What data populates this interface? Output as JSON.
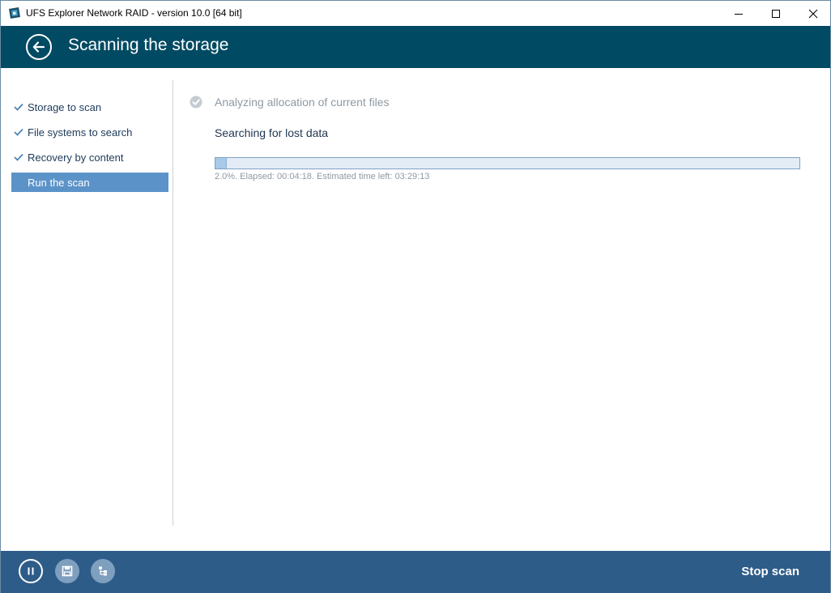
{
  "window": {
    "title": "UFS Explorer Network RAID - version 10.0 [64 bit]",
    "controls": [
      "minimize-icon",
      "maximize-icon",
      "close-icon"
    ]
  },
  "header": {
    "title": "Scanning the storage",
    "back_icon": "back-arrow-icon"
  },
  "sidebar": {
    "steps": [
      {
        "label": "Storage to scan",
        "state": "done"
      },
      {
        "label": "File systems to search",
        "state": "done"
      },
      {
        "label": "Recovery by content",
        "state": "done"
      },
      {
        "label": "Run the scan",
        "state": "active"
      }
    ]
  },
  "main": {
    "completed_phase": "Analyzing allocation of current files",
    "current_phase": "Searching for lost data",
    "progress_percent": 2.0,
    "progress_text": "2.0%. Elapsed: 00:04:18. Estimated time left: 03:29:13"
  },
  "footer": {
    "buttons": [
      "pause-icon",
      "save-icon",
      "tree-icon"
    ],
    "stop_label": "Stop scan"
  },
  "colors": {
    "header_bg": "#004a63",
    "footer_bg": "#2e5c89",
    "active_step": "#5b93c9",
    "progress_fill": "#a9c9e8"
  }
}
